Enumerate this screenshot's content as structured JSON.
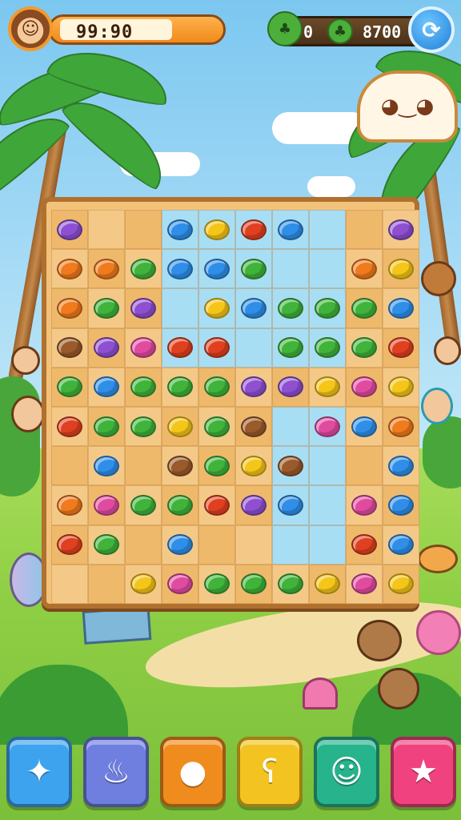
{
  "hud": {
    "score": "99:90",
    "resource_left": "0",
    "resource_right": "8700"
  },
  "board": {
    "cols": 10,
    "rows": 10,
    "colors": {
      "purple": "#8e4fd1",
      "blue": "#2f8ee8",
      "yellow": "#f5c518",
      "red": "#e0401f",
      "green": "#3fb33a",
      "orange": "#f07a1c",
      "pink": "#e04ba0",
      "brown": "#9a5a2a"
    },
    "tiles": [
      [
        "purple",
        "empty",
        "empty",
        "blue",
        "yellow",
        "red",
        "blue",
        "empty",
        "empty",
        "purple"
      ],
      [
        "orange",
        "orange",
        "green",
        "blue",
        "blue",
        "green",
        "empty",
        "empty",
        "orange",
        "yellow"
      ],
      [
        "orange",
        "green",
        "purple",
        "empty",
        "yellow",
        "blue",
        "green",
        "green",
        "green",
        "blue"
      ],
      [
        "brown",
        "purple",
        "pink",
        "red",
        "red",
        "empty",
        "green",
        "green",
        "green",
        "red"
      ],
      [
        "green",
        "blue",
        "green",
        "green",
        "green",
        "purple",
        "purple",
        "yellow",
        "pink",
        "yellow"
      ],
      [
        "red",
        "green",
        "green",
        "yellow",
        "green",
        "brown",
        "empty",
        "pink",
        "blue",
        "orange"
      ],
      [
        "empty",
        "blue",
        "empty",
        "brown",
        "green",
        "yellow",
        "brown",
        "empty",
        "empty",
        "blue"
      ],
      [
        "orange",
        "pink",
        "green",
        "green",
        "red",
        "purple",
        "blue",
        "empty",
        "pink",
        "blue"
      ],
      [
        "red",
        "green",
        "empty",
        "blue",
        "empty",
        "empty",
        "empty",
        "empty",
        "red",
        "blue"
      ],
      [
        "empty",
        "empty",
        "yellow",
        "pink",
        "green",
        "green",
        "green",
        "yellow",
        "pink",
        "yellow"
      ]
    ]
  },
  "powerups": [
    {
      "name": "wand-powerup-button",
      "icon": "wand-icon",
      "glyph": "✦",
      "color": "#3ea3ef"
    },
    {
      "name": "potion-powerup-button",
      "icon": "potion-icon",
      "glyph": "♨",
      "color": "#6f7fe0"
    },
    {
      "name": "lemon-powerup-button",
      "icon": "lemon-icon",
      "glyph": "●",
      "color": "#f08b1e"
    },
    {
      "name": "bear-powerup-button",
      "icon": "bear-icon",
      "glyph": "ʕ",
      "color": "#f3c321"
    },
    {
      "name": "monkey-powerup-button",
      "icon": "monkey-icon",
      "glyph": "☺",
      "color": "#27b38c"
    },
    {
      "name": "star-powerup-button",
      "icon": "star-icon",
      "glyph": "★",
      "color": "#f0427e"
    }
  ]
}
